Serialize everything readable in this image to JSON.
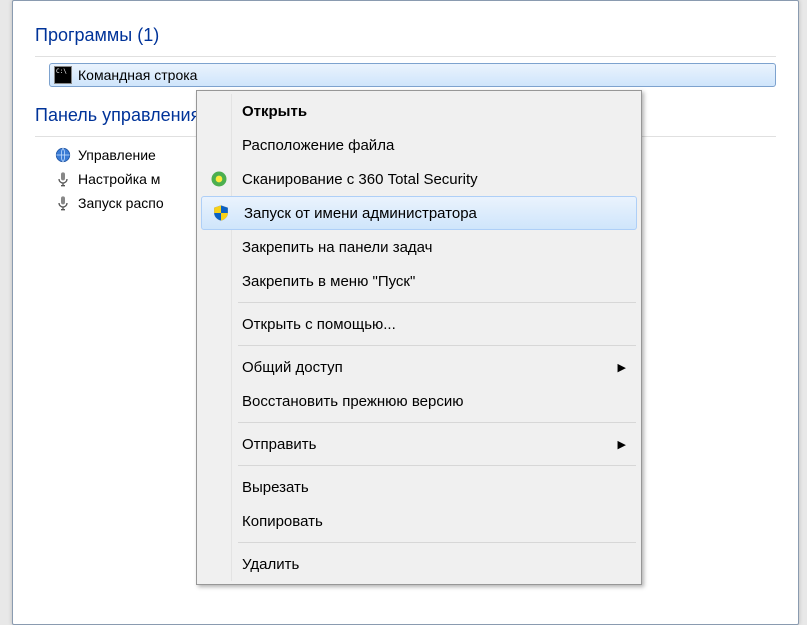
{
  "sections": {
    "programs_header": "Программы (1)",
    "control_panel_header": "Панель управления"
  },
  "programs": {
    "cmd_label": "Командная строка"
  },
  "control_items": {
    "item0": "Управление",
    "item1": "Настройка м",
    "item2": "Запуск распо"
  },
  "context_menu": {
    "open": "Открыть",
    "file_location": "Расположение файла",
    "scan_360": "Сканирование с 360 Total Security",
    "run_as_admin": "Запуск от имени администратора",
    "pin_taskbar": "Закрепить на панели задач",
    "pin_start": "Закрепить в меню \"Пуск\"",
    "open_with": "Открыть с помощью...",
    "share": "Общий доступ",
    "restore_prev": "Восстановить прежнюю версию",
    "send_to": "Отправить",
    "cut": "Вырезать",
    "copy": "Копировать",
    "delete": "Удалить"
  }
}
